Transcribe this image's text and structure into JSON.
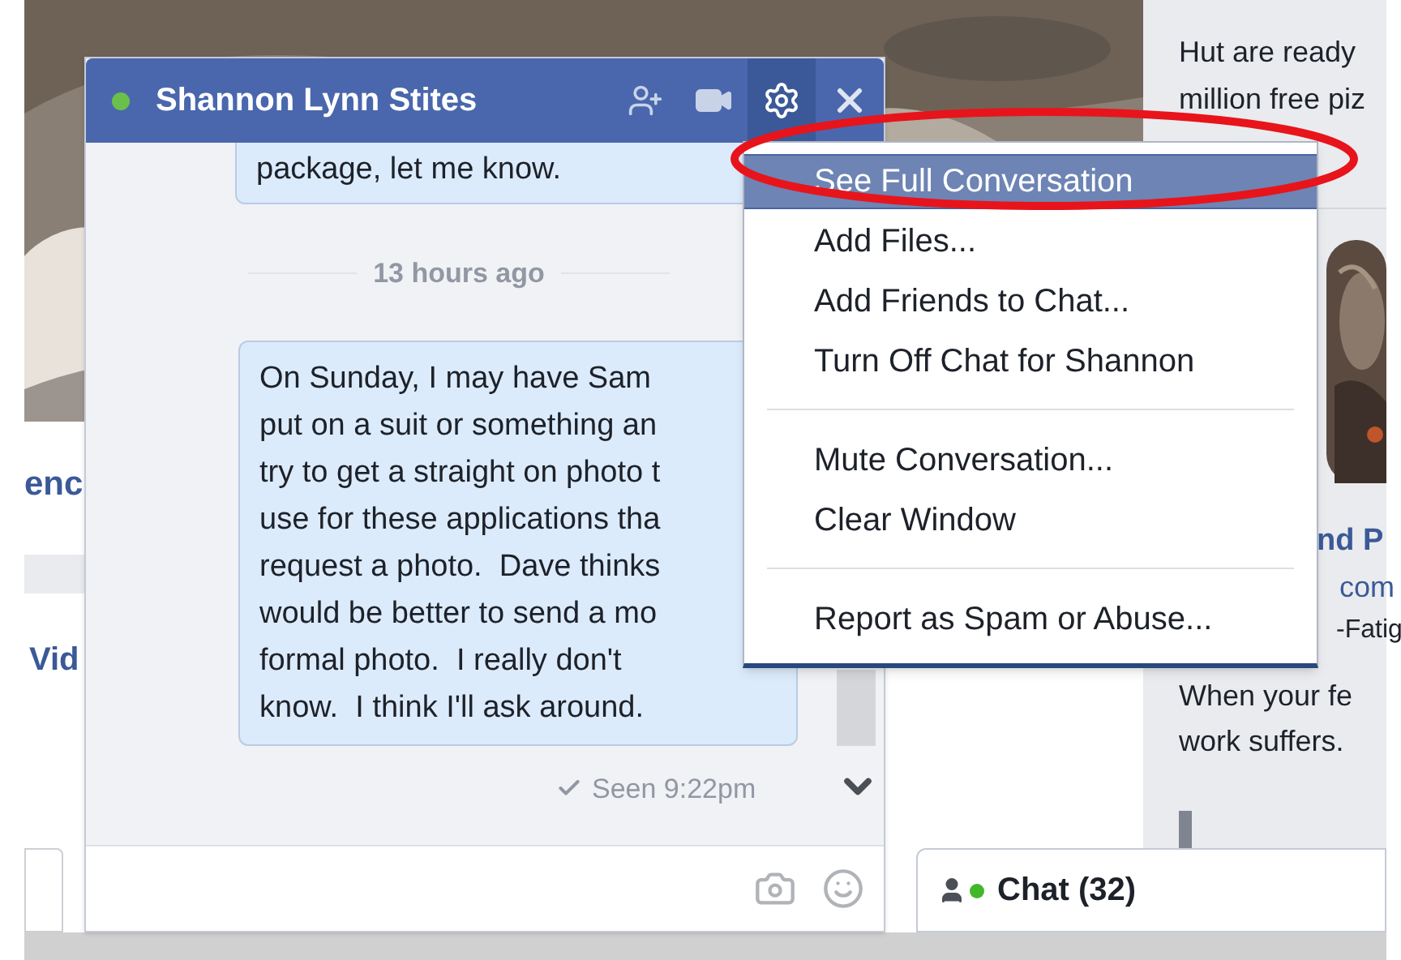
{
  "page": {
    "left_link": "enc",
    "left_tab": "Vid",
    "sidebar_top": [
      "Hut are ready",
      "million free piz"
    ],
    "sidebar_link": "nd P",
    "sidebar_domain": "com",
    "sidebar_title": "-Fatig",
    "sidebar_body": [
      "When your fe",
      "work suffers."
    ]
  },
  "chat": {
    "contact": "Shannon Lynn Stites",
    "online": true,
    "messages": [
      {
        "lines": [
          "package, let me know."
        ]
      },
      {
        "lines": [
          "On Sunday, I may have Sam",
          "put on a suit or something an",
          "try to get a straight on photo t",
          "use for these applications tha",
          "request a photo.  Dave thinks",
          "would be better to send a mo",
          "formal photo.  I really don't",
          "know.  I think I'll ask around."
        ]
      }
    ],
    "timestamp": "13 hours ago",
    "seen": "Seen 9:22pm"
  },
  "menu": {
    "groups": [
      {
        "items": [
          {
            "label": "See Full Conversation",
            "selected": true
          },
          {
            "label": "Add Files...",
            "selected": false
          },
          {
            "label": "Add Friends to Chat...",
            "selected": false
          },
          {
            "label": "Turn Off Chat for Shannon",
            "selected": false
          }
        ]
      },
      {
        "items": [
          {
            "label": "Mute Conversation...",
            "selected": false
          },
          {
            "label": "Clear Window",
            "selected": false
          }
        ]
      },
      {
        "items": [
          {
            "label": "Report as Spam or Abuse...",
            "selected": false
          }
        ]
      }
    ]
  },
  "chat_bar": {
    "label": "Chat (32)",
    "online": true
  }
}
